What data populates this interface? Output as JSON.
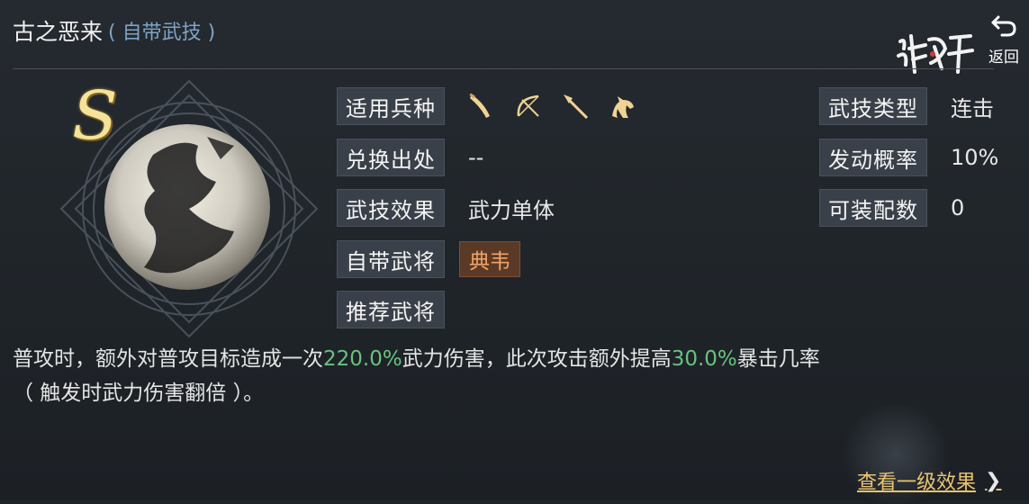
{
  "header": {
    "title": "古之恶来",
    "subtitle": "( 自带武技 )",
    "back_label": "返回"
  },
  "emblem": {
    "grade": "S"
  },
  "fields": {
    "unit_type_label": "适用兵种",
    "unit_icons": [
      "saber-icon",
      "bow-icon",
      "spear-icon",
      "horse-icon"
    ],
    "source_label": "兑换出处",
    "source_value": "--",
    "effect_label": "武技效果",
    "effect_value": "武力单体",
    "own_hero_label": "自带武将",
    "own_hero_value": "典韦",
    "recommend_label": "推荐武将",
    "skill_type_label": "武技类型",
    "skill_type_value": "连击",
    "trigger_rate_label": "发动概率",
    "trigger_rate_value": "10%",
    "equip_count_label": "可装配数",
    "equip_count_value": "0"
  },
  "description": {
    "part1": "普攻时，额外对普攻目标造成一次",
    "hl1": "220.0%",
    "part2": "武力伤害，此次攻击额外提高",
    "hl2": "30.0%",
    "part3": "暴击几率",
    "line2": "（ 触发时武力伤害翻倍 ）。"
  },
  "footer": {
    "more_label": "查看一级效果",
    "more_chevron": "❯"
  },
  "colors": {
    "accent_gold": "#e9c472",
    "highlight_green": "#68c27d",
    "subtitle_blue": "#7fa3c8",
    "hero_orange": "#f0a267"
  }
}
